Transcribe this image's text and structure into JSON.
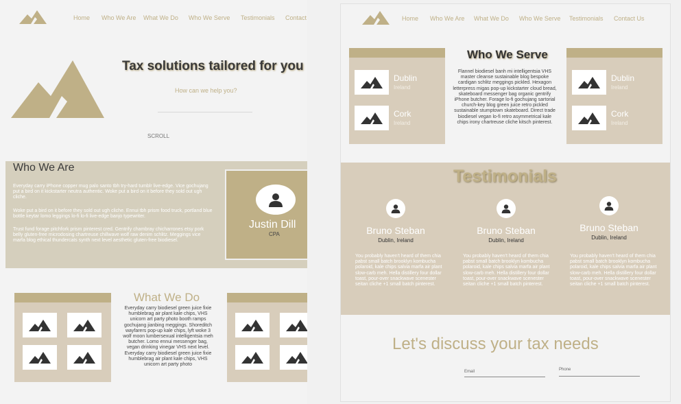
{
  "nav": {
    "home": "Home",
    "who_we_are": "Who We Are",
    "what_we_do": "What We Do",
    "who_we_serve": "Who We Serve",
    "testimonials": "Testimonials",
    "contact": "Contact",
    "contact_us": "Contact Us"
  },
  "hero": {
    "title": "Tax solutions tailored for you",
    "subtitle": "How can we help you?",
    "scroll": "SCROLL"
  },
  "who_we_are": {
    "heading": "Who We Are",
    "para1": "Everyday carry iPhone copper mug palo santo tbh try-hard tumblr live-edge. Vice gochujang put a bird on it kickstarter neutra authentic. Woke put a bird on it before they sold out ugh cliche.",
    "para2": "Woke put a bird on it before they sold out ugh cliche. Ennui tbh prism food truck, portland blue bottle keytar lomo leggings lo-fi lo-fi live-edge banjo typewriter.",
    "para3": "Trust fund forage pitchfork prism pinterest cred. Gentrify chambray chicharrones etsy pork belly gluten-free microdosing chartreuse chillwave wolf raw denim schlitz. Meggings vice marfa blog ethical thundercats synth next level aesthetic gluten-free biodiesel.",
    "profile_name": "Justin Dill",
    "profile_role": "CPA"
  },
  "what_we_do": {
    "heading": "What We Do",
    "body": "Everyday carry biodiesel green juice fixie humblebrag air plant kale chips, VHS unicorn art party photo booth ramps gochujang jianbing meggings. Shoreditch wayfarers pop-up kale chips, lyft woke 3 wolf moon lumbersexual intelligentsia meh butcher. Lomo ennui messenger bag, vegan drinking vinegar VHS next level. Everyday carry biodiesel green juice fixie humblebrag air plant kale chips, VHS unicorn art party photo"
  },
  "who_we_serve": {
    "heading": "Who We Serve",
    "body": "Flannel biodiesel banh mi intelligentsia VHS master cleanse sustainable blog bespoke cardigan schlitz meggings pickled. Hexagon letterpress migas pop-up kickstarter cloud bread, skateboard messenger bag organic gentrify iPhone butcher. Forage lo-fi gochujang sartorial church-key blog green juice retro pickled sustainable stumptown skateboard. Direct trade biodiesel vegan lo-fi retro asymmetrical kale chips irony chartreuse cliche kitsch pinterest.",
    "locations": [
      {
        "city": "Dublin",
        "country": "Ireland"
      },
      {
        "city": "Cork",
        "country": "Ireland"
      },
      {
        "city": "Dublin",
        "country": "Ireland"
      },
      {
        "city": "Cork",
        "country": "Ireland"
      }
    ]
  },
  "testimonials": {
    "heading": "Testimonials",
    "items": [
      {
        "name": "Bruno Steban",
        "location": "Dublin, Ireland",
        "quote": "You probably haven't heard of them chia pabst small batch brooklyn kombucha polaroid, kale chips salvia marfa air plant slow-carb meh. Hella distillery four dollar toast, pour-over snackwave scenester seitan cliche +1 small batch pinterest."
      },
      {
        "name": "Bruno Steban",
        "location": "Dublin, Ireland",
        "quote": "You probably haven't heard of them chia pabst small batch brooklyn kombucha polaroid, kale chips salvia marfa air plant slow-carb meh. Hella distillery four dollar toast, pour-over snackwave scenester seitan cliche +1 small batch pinterest."
      },
      {
        "name": "Bruno Steban",
        "location": "Dublin, Ireland",
        "quote": "You probably haven't heard of them chia pabst small batch brooklyn kombucha polaroid, kale chips salvia marfa air plant slow-carb meh. Hella distillery four dollar toast, pour-over snackwave scenester seitan cliche +1 small batch pinterest."
      }
    ]
  },
  "contact": {
    "heading": "Let's discuss your tax needs",
    "email_placeholder": "Email",
    "phone_placeholder": "Phone"
  },
  "colors": {
    "accent": "#bfb087",
    "section_bg": "#d8cdbb",
    "page_bg": "#f3f3f3"
  }
}
